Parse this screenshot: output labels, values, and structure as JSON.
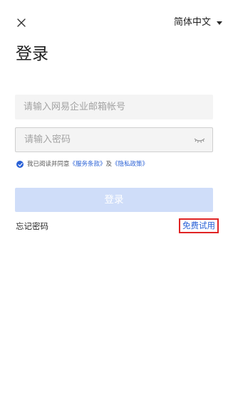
{
  "header": {
    "close_icon": "close-icon",
    "language": "简体中文",
    "language_caret_icon": "caret-down-icon"
  },
  "page": {
    "title": "登录"
  },
  "form": {
    "account_placeholder": "请输入网易企业邮箱帐号",
    "account_value": "",
    "password_placeholder": "请输入密码",
    "password_value": "",
    "password_visibility_icon": "eye-closed-icon"
  },
  "agreement": {
    "prefix": "我已阅读并同意",
    "terms_link": "《服务条款》",
    "conjunction": "及",
    "privacy_link": "《隐私政策》",
    "checked": true
  },
  "actions": {
    "login_label": "登录",
    "forgot_password_label": "忘记密码",
    "free_trial_label": "免费试用"
  },
  "colors": {
    "accent": "#2a61d6",
    "login_button_disabled": "#cfddf9",
    "input_background": "#f4f4f4",
    "highlight_border": "#e02424"
  }
}
